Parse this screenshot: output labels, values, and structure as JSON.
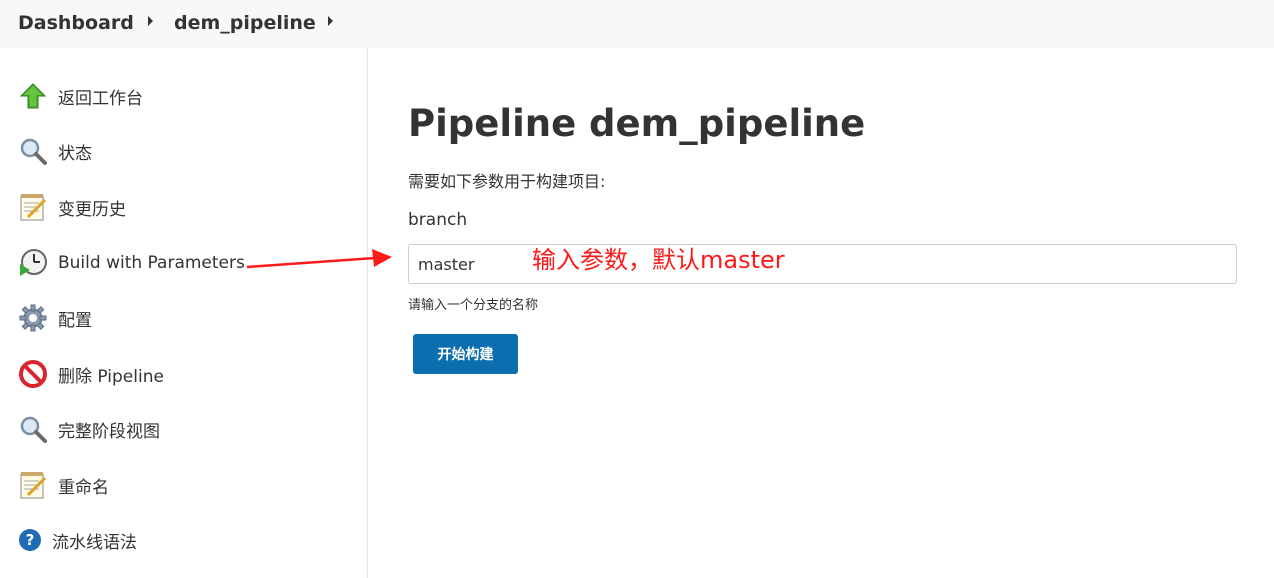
{
  "breadcrumb": {
    "items": [
      {
        "label": "Dashboard"
      },
      {
        "label": "dem_pipeline"
      }
    ]
  },
  "sidebar": {
    "items": [
      {
        "label": "返回工作台",
        "icon": "up-arrow-icon"
      },
      {
        "label": "状态",
        "icon": "magnifier-icon"
      },
      {
        "label": "变更历史",
        "icon": "notepad-icon"
      },
      {
        "label": "Build with Parameters",
        "icon": "clock-play-icon"
      },
      {
        "label": "配置",
        "icon": "gear-icon"
      },
      {
        "label": "删除 Pipeline",
        "icon": "no-entry-icon"
      },
      {
        "label": "完整阶段视图",
        "icon": "magnifier-icon"
      },
      {
        "label": "重命名",
        "icon": "notepad-icon"
      },
      {
        "label": "流水线语法",
        "icon": "help-icon"
      }
    ]
  },
  "main": {
    "title": "Pipeline dem_pipeline",
    "description": "需要如下参数用于构建项目:",
    "parameter": {
      "name": "branch",
      "value": "master",
      "help": "请输入一个分支的名称"
    },
    "build_button": "开始构建"
  },
  "annotation": {
    "text": "输入参数，默认master",
    "color": "#ff1a1a"
  },
  "colors": {
    "accent": "#0c6eae",
    "breadcrumb_bg": "#f8f8f8"
  }
}
